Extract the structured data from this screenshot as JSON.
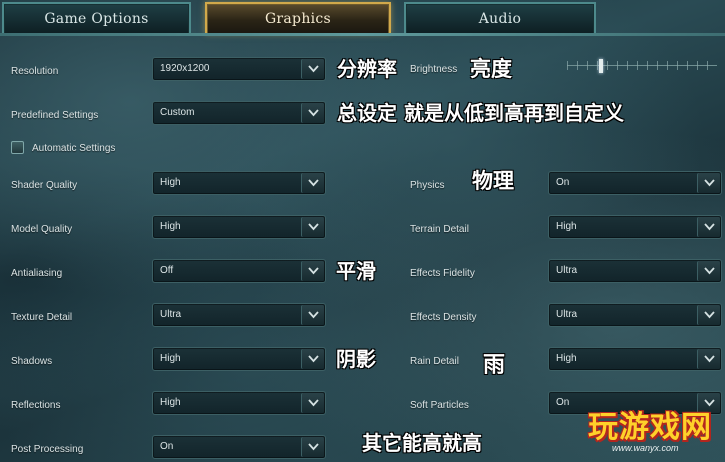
{
  "tabs": [
    {
      "label": "Game Options",
      "active": false
    },
    {
      "label": "Graphics",
      "active": true
    },
    {
      "label": "Audio",
      "active": false
    }
  ],
  "left_settings": {
    "resolution": {
      "label": "Resolution",
      "value": "1920x1200"
    },
    "predefined": {
      "label": "Predefined Settings",
      "value": "Custom"
    },
    "automatic": {
      "label": "Automatic Settings",
      "checked": false
    },
    "shader_quality": {
      "label": "Shader Quality",
      "value": "High"
    },
    "model_quality": {
      "label": "Model Quality",
      "value": "High"
    },
    "antialiasing": {
      "label": "Antialiasing",
      "value": "Off"
    },
    "texture_detail": {
      "label": "Texture Detail",
      "value": "Ultra"
    },
    "shadows": {
      "label": "Shadows",
      "value": "High"
    },
    "reflections": {
      "label": "Reflections",
      "value": "High"
    },
    "post_processing": {
      "label": "Post Processing",
      "value": "On"
    }
  },
  "right_settings": {
    "brightness": {
      "label": "Brightness",
      "level": 0.22
    },
    "physics": {
      "label": "Physics",
      "value": "On"
    },
    "terrain_detail": {
      "label": "Terrain Detail",
      "value": "High"
    },
    "effects_fidelity": {
      "label": "Effects Fidelity",
      "value": "Ultra"
    },
    "effects_density": {
      "label": "Effects Density",
      "value": "Ultra"
    },
    "rain_detail": {
      "label": "Rain Detail",
      "value": "High"
    },
    "soft_particles": {
      "label": "Soft Particles",
      "value": "On"
    }
  },
  "annotations": {
    "resolution": "分辨率",
    "brightness": "亮度",
    "predefined": "总设定 就是从低到高再到自定义",
    "physics": "物理",
    "antialiasing": "平滑",
    "shadows": "阴影",
    "rain": "雨",
    "others": "其它能高就高"
  },
  "watermark": {
    "main": "玩游戏网",
    "url": "www.wanyx.com"
  },
  "icons": {
    "dropdown_arrow": "chevron-down-icon"
  }
}
